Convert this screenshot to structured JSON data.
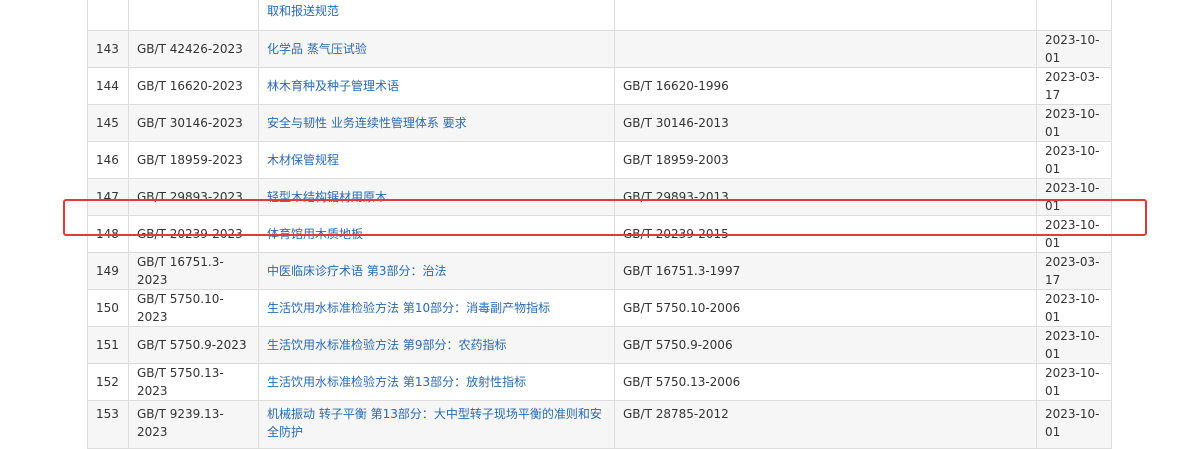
{
  "table": {
    "first_row_name": "取和报送规范",
    "rows": [
      {
        "num": "143",
        "code": "GB/T 42426-2023",
        "name": "化学品 蒸气压试验",
        "replaced": "",
        "date": "2023-10-01"
      },
      {
        "num": "144",
        "code": "GB/T 16620-2023",
        "name": "林木育种及种子管理术语",
        "replaced": "GB/T 16620-1996",
        "date": "2023-03-17"
      },
      {
        "num": "145",
        "code": "GB/T 30146-2023",
        "name": "安全与韧性 业务连续性管理体系 要求",
        "replaced": "GB/T 30146-2013",
        "date": "2023-10-01"
      },
      {
        "num": "146",
        "code": "GB/T 18959-2023",
        "name": "木材保管规程",
        "replaced": "GB/T 18959-2003",
        "date": "2023-10-01"
      },
      {
        "num": "147",
        "code": "GB/T 29893-2023",
        "name": "轻型木结构锯材用原木",
        "replaced": "GB/T 29893-2013",
        "date": "2023-10-01"
      },
      {
        "num": "148",
        "code": "GB/T 20239-2023",
        "name": "体育馆用木质地板",
        "replaced": "GB/T 20239-2015",
        "date": "2023-10-01"
      },
      {
        "num": "149",
        "code": "GB/T 16751.3-2023",
        "name": "中医临床诊疗术语 第3部分：治法",
        "replaced": "GB/T 16751.3-1997",
        "date": "2023-03-17"
      },
      {
        "num": "150",
        "code": "GB/T 5750.10-2023",
        "name": "生活饮用水标准检验方法 第10部分：消毒副产物指标",
        "replaced": "GB/T 5750.10-2006",
        "date": "2023-10-01"
      },
      {
        "num": "151",
        "code": "GB/T 5750.9-2023",
        "name": "生活饮用水标准检验方法 第9部分：农药指标",
        "replaced": "GB/T 5750.9-2006",
        "date": "2023-10-01"
      },
      {
        "num": "152",
        "code": "GB/T 5750.13-2023",
        "name": "生活饮用水标准检验方法 第13部分：放射性指标",
        "replaced": "GB/T 5750.13-2006",
        "date": "2023-10-01"
      },
      {
        "num": "153",
        "code": "GB/T 9239.13-2023",
        "name": "机械振动 转子平衡 第13部分：大中型转子现场平衡的准则和安全防护",
        "replaced": "GB/T 28785-2012",
        "date": "2023-10-01"
      }
    ]
  },
  "colors": {
    "link": "#2a6ab2",
    "highlight": "#e03a3a",
    "row_alt": "#f6f6f6",
    "border": "#dddddd"
  }
}
